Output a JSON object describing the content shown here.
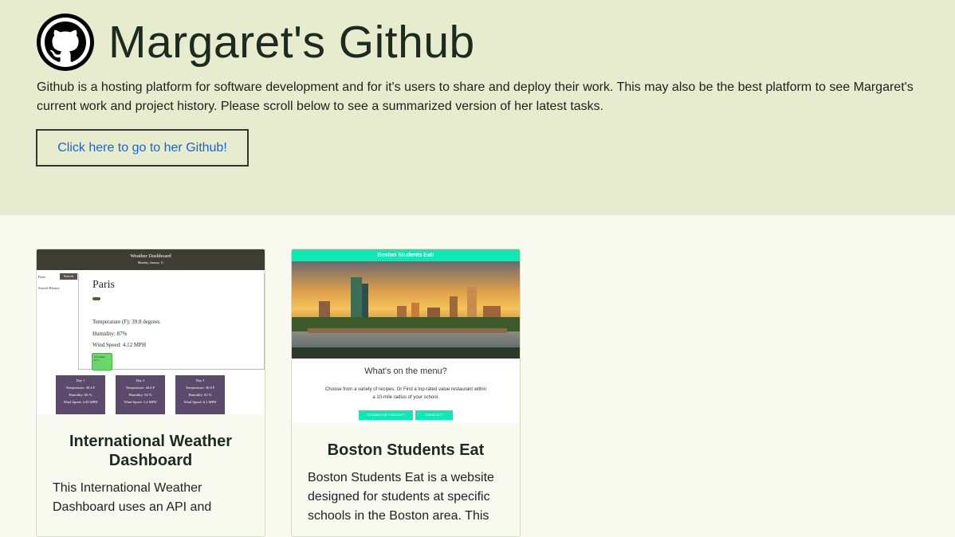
{
  "hero": {
    "title": "Margaret's Github",
    "description": "Github is a hosting platform for software development and for it's users to share and deploy their work. This may also be the best platform to see Margaret's current work and project history. Please scroll below to see a summarized version of her latest tasks.",
    "button_label": "Click here to go to her Github!"
  },
  "cards": [
    {
      "title": "International Weather Dashboard",
      "description": "This International Weather Dashboard uses an API and",
      "thumbnail": {
        "header_title": "Weather Dashboard",
        "header_date": "Monday, January 11",
        "search_city": "Paris",
        "search_button": "Search",
        "search_history": "Search History",
        "city": "Paris",
        "temperature": "Temperature (F): 39.8 degrees",
        "humidity": "Humidity: 87%",
        "wind": "Wind Speed: 4.12 MPH",
        "uv_label": "UV Index",
        "uv_value": "0.71",
        "days": [
          {
            "label": "Day 1",
            "temp": "Temperature: 40.4 F",
            "humidity": "Humidity: 86 %",
            "wind": "Wind Speed: 4.49 MPH"
          },
          {
            "label": "Day 2",
            "temp": "Temperature: 44.6 F",
            "humidity": "Humidity: 94 %",
            "wind": "Wind Speed: 1.4 MPH"
          },
          {
            "label": "Day 3",
            "temp": "Temperature: 46.8 F",
            "humidity": "Humidity: 82 %",
            "wind": "Wind Speed: 6.1 MPH"
          }
        ]
      }
    },
    {
      "title": "Boston Students Eat",
      "description": "Boston Students Eat is a website designed for students at specific schools in the Boston area. This",
      "thumbnail": {
        "header_title": "Boston Students Eat!",
        "question": "What's on the menu?",
        "text": "Choose from a variety of recipes. Or Find a top-rated value restaurant within a 10-mile radius of your school.",
        "button1": "COOKING FOR YOURSELF?",
        "button2": "DINING OUT?"
      }
    }
  ],
  "colors": {
    "hero_bg": "#e8ecce",
    "page_bg": "#f8faf0",
    "link": "#1464d8",
    "weather_day": "#5b4a6b",
    "boston_accent": "#0fe8b5"
  }
}
